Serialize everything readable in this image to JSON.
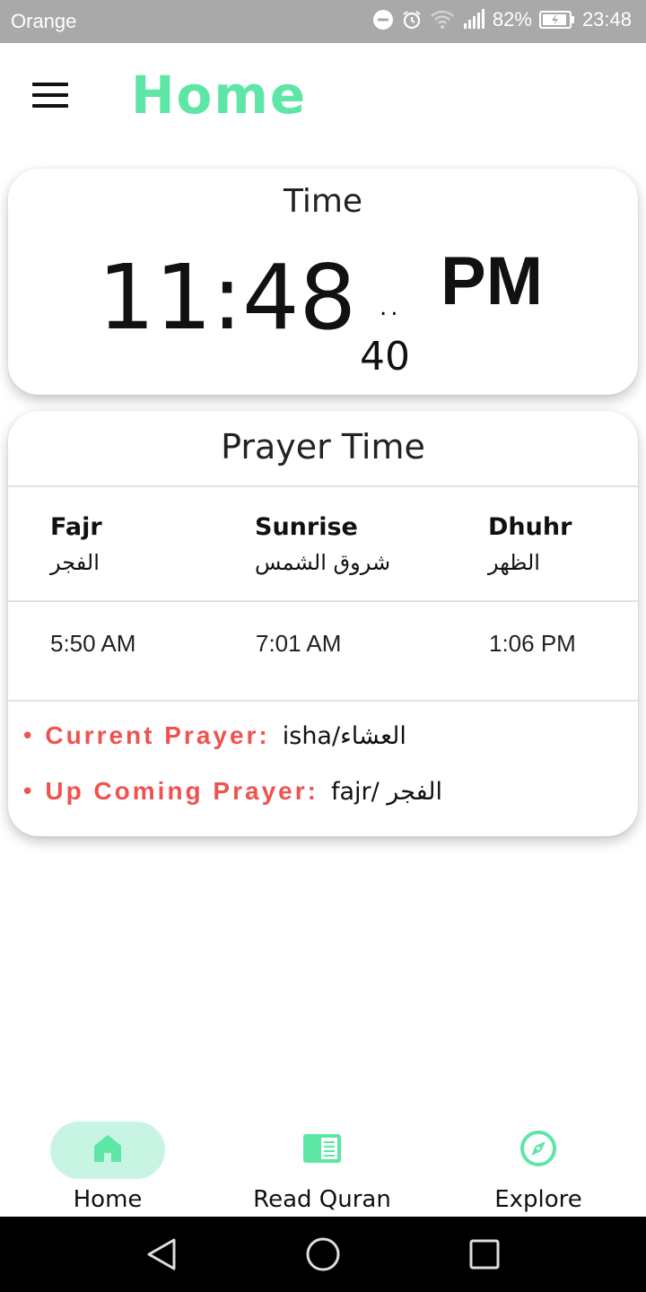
{
  "status_bar": {
    "carrier": "Orange",
    "battery": "82%",
    "time": "23:48",
    "icons": [
      "dnd-icon",
      "alarm-icon",
      "wifi-icon",
      "signal-icon",
      "battery-icon"
    ]
  },
  "header": {
    "title": "Home",
    "menu_icon": "hamburger-menu-icon"
  },
  "time_card": {
    "label": "Time",
    "clock": "11:48",
    "seconds_separator": "..",
    "seconds": "40",
    "ampm": "PM"
  },
  "prayer_card": {
    "title": "Prayer Time",
    "prayers": [
      {
        "name": "Fajr",
        "arabic": "الفجر",
        "time": "5:50 AM"
      },
      {
        "name": "Sunrise",
        "arabic": "شروق الشمس",
        "time": "7:01 AM"
      },
      {
        "name": "Dhuhr",
        "arabic": "الظهر",
        "time": "1:06 PM"
      }
    ],
    "current_label": "Current Prayer:",
    "current_value": "isha/العشاء",
    "upcoming_label": "Up Coming Prayer:",
    "upcoming_value": "fajr/ الفجر",
    "bullet": "•"
  },
  "bottom_nav": {
    "items": [
      {
        "label": "Home",
        "icon": "home-icon",
        "active": true
      },
      {
        "label": "Read Quran",
        "icon": "book-icon",
        "active": false
      },
      {
        "label": "Explore",
        "icon": "compass-icon",
        "active": false
      }
    ]
  },
  "colors": {
    "accent": "#5ee6a6",
    "accent_light": "#c8f5e3",
    "status_red": "#ef5350",
    "status_bar_bg": "#a9a9a9"
  }
}
